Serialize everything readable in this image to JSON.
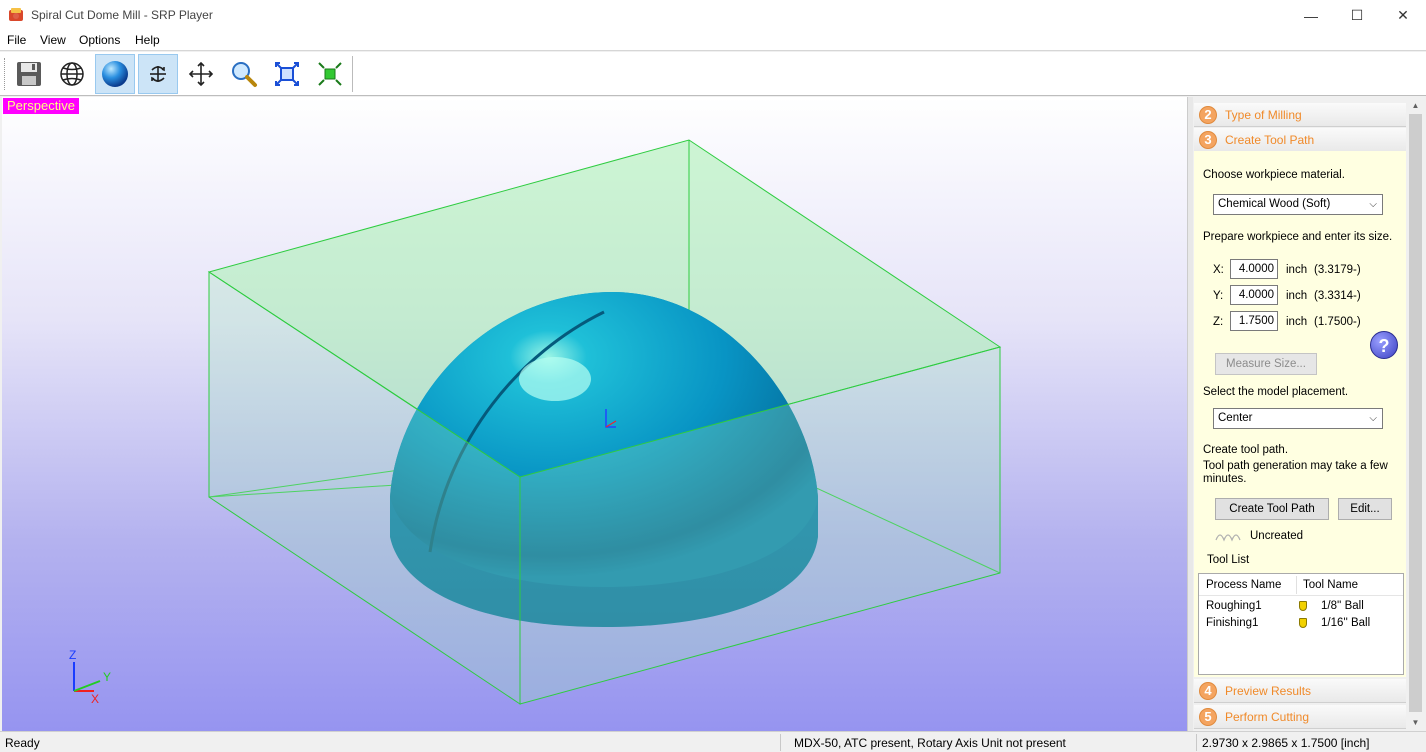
{
  "window": {
    "title": "Spiral Cut Dome Mill - SRP Player",
    "minimize_glyph": "—",
    "maximize_glyph": "☐",
    "close_glyph": "✕"
  },
  "menu": {
    "items": [
      "File",
      "View",
      "Options",
      "Help"
    ]
  },
  "toolbar": {
    "buttons": [
      {
        "icon": "save-icon",
        "active": false
      },
      {
        "icon": "wireframe-globe-icon",
        "active": false
      },
      {
        "icon": "shaded-sphere-icon",
        "active": true
      },
      {
        "icon": "rotate-icon",
        "active": true
      },
      {
        "icon": "pan-icon",
        "active": false
      },
      {
        "icon": "zoom-icon",
        "active": false
      },
      {
        "icon": "fit-view-icon",
        "active": false
      },
      {
        "icon": "zoom-to-model-icon",
        "active": false
      }
    ]
  },
  "viewport": {
    "view_label": "Perspective",
    "axis_z": "Z",
    "axis_y": "Y",
    "axis_x": "X",
    "model_color": "#0a9ac8",
    "bbox_color": "#2ecc40"
  },
  "panel": {
    "steps": [
      {
        "number": "2",
        "label": "Type of Milling"
      },
      {
        "number": "3",
        "label": "Create Tool Path"
      },
      {
        "number": "4",
        "label": "Preview Results"
      },
      {
        "number": "5",
        "label": "Perform Cutting"
      }
    ],
    "choose_material_label": "Choose workpiece material.",
    "material_value": "Chemical Wood (Soft)",
    "prepare_label": "Prepare workpiece and enter its size.",
    "size": {
      "x_label": "X:",
      "x_value": "4.0000",
      "x_unit": "inch",
      "x_hint": "(3.3179-)",
      "y_label": "Y:",
      "y_value": "4.0000",
      "y_unit": "inch",
      "y_hint": "(3.3314-)",
      "z_label": "Z:",
      "z_value": "1.7500",
      "z_unit": "inch",
      "z_hint": "(1.7500-)"
    },
    "help_glyph": "?",
    "measure_button": "Measure Size...",
    "placement_label": "Select the model placement.",
    "placement_value": "Center",
    "create_label": "Create tool path.",
    "create_note": "Tool path generation may take a few minutes.",
    "create_button": "Create Tool Path",
    "edit_button": "Edit...",
    "path_status": "Uncreated",
    "tool_list_label": "Tool List",
    "tool_list": {
      "headers": [
        "Process Name",
        "Tool Name"
      ],
      "rows": [
        {
          "process": "Roughing1",
          "tool": "1/8'' Ball"
        },
        {
          "process": "Finishing1",
          "tool": "1/16'' Ball"
        }
      ]
    }
  },
  "status": {
    "left": "Ready",
    "middle": "MDX-50, ATC present, Rotary Axis Unit not present",
    "right": "2.9730 x 2.9865 x 1.7500 [inch]"
  }
}
